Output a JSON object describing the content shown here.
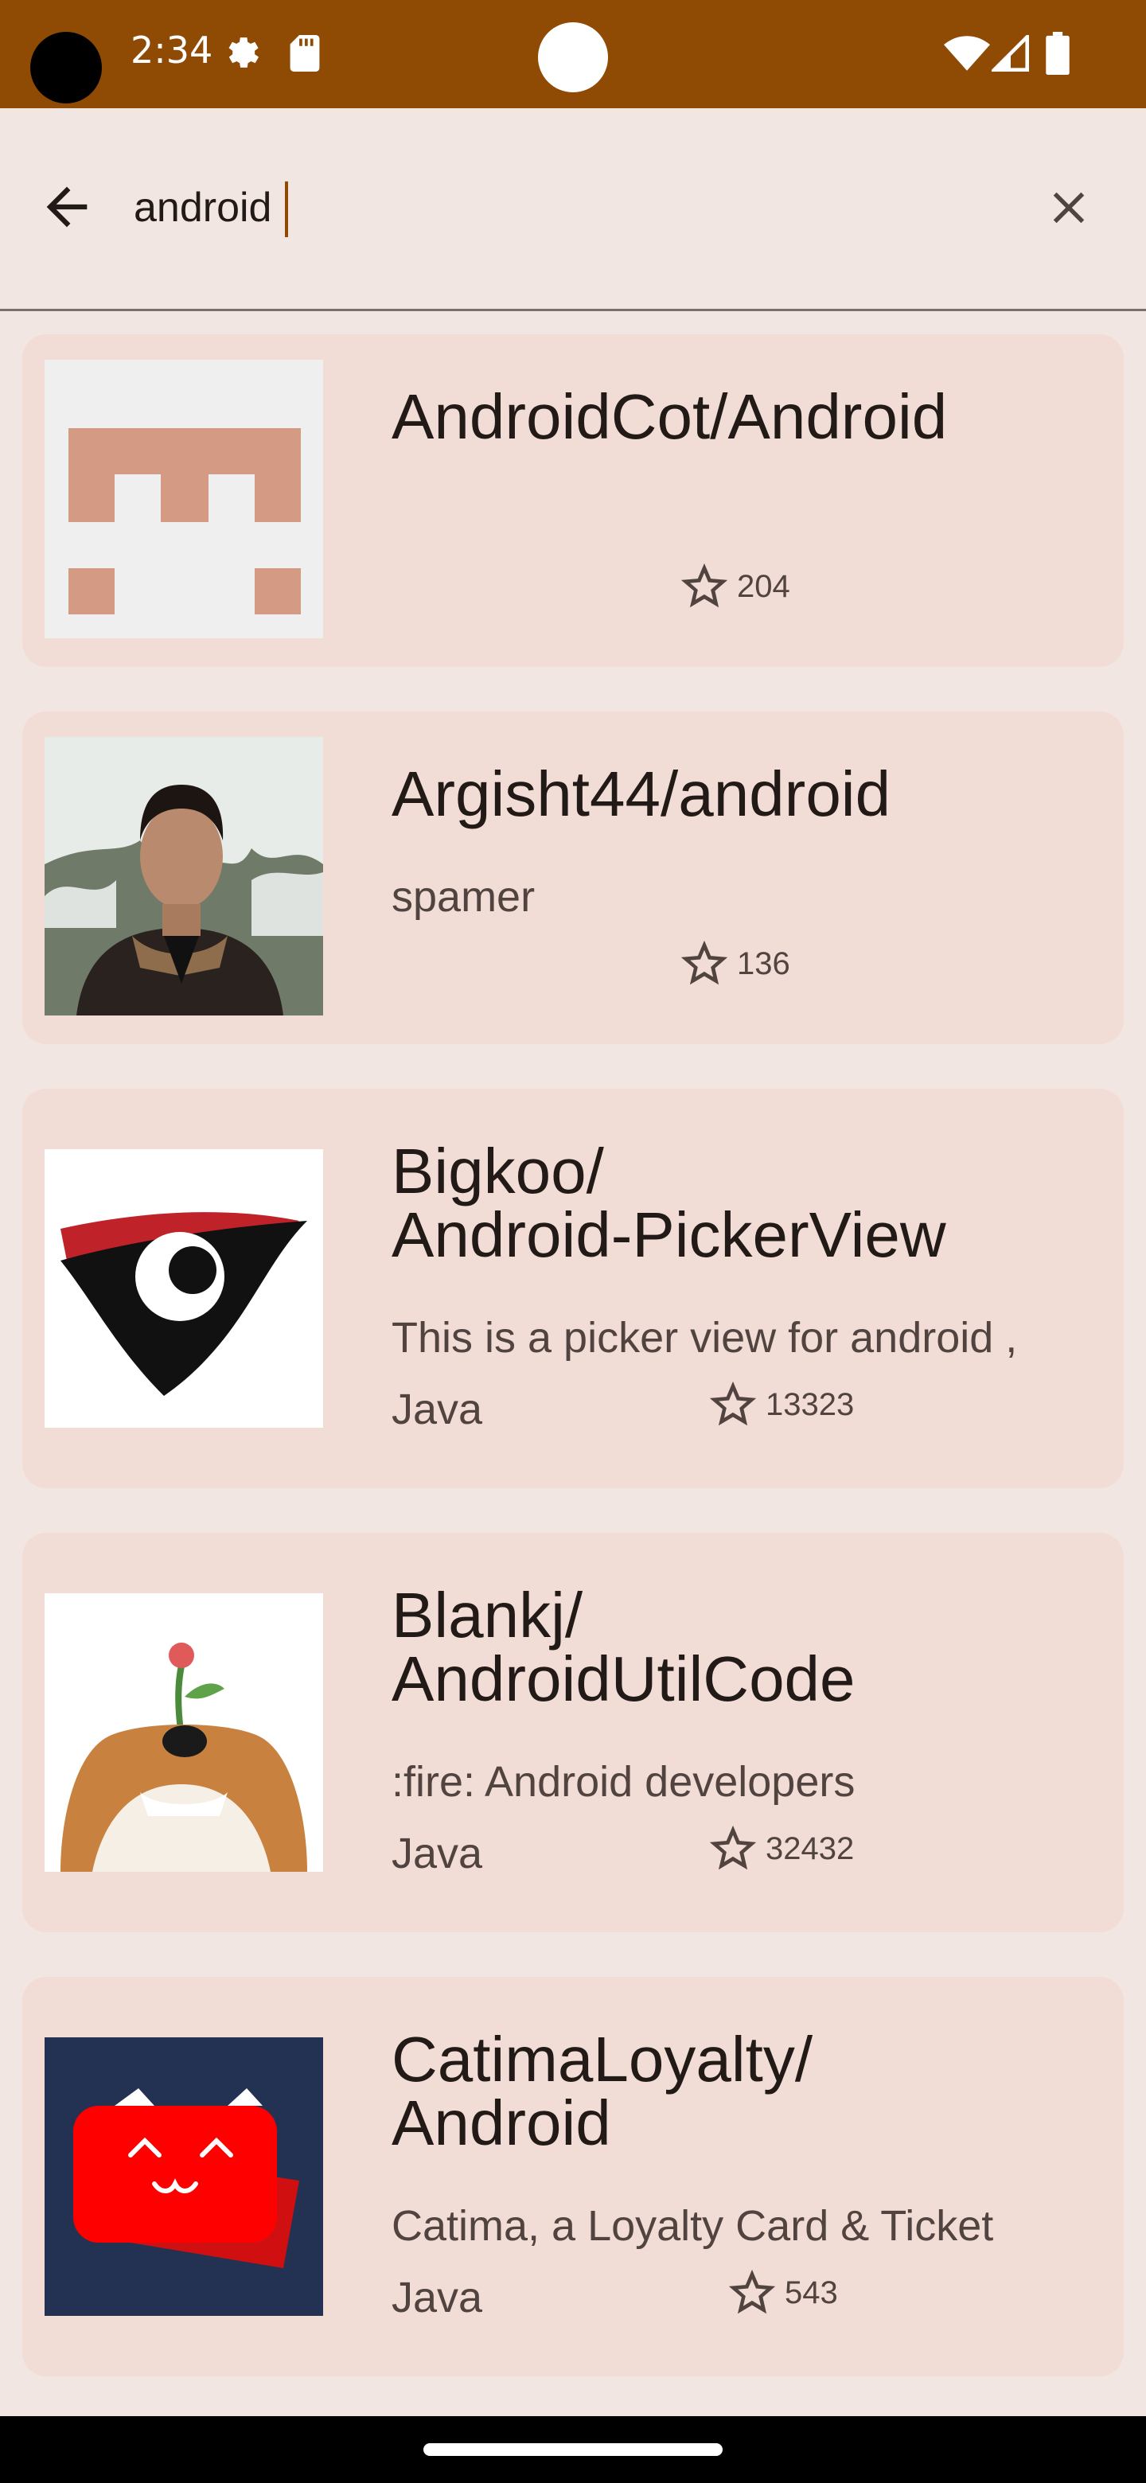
{
  "status": {
    "time": "2:34"
  },
  "search": {
    "value": "android"
  },
  "results": [
    {
      "title": "AndroidCot/Android",
      "description": "",
      "language": "",
      "stars": "204"
    },
    {
      "title": "Argisht44/android",
      "description": "spamer",
      "language": "",
      "stars": "136"
    },
    {
      "title": "Bigkoo/\nAndroid-PickerView",
      "description": "This is a picker view for android ,",
      "language": "Java",
      "stars": "13323"
    },
    {
      "title": "Blankj/\nAndroidUtilCode",
      "description": ":fire: Android developers",
      "language": "Java",
      "stars": "32432"
    },
    {
      "title": "CatimaLoyalty/\nAndroid",
      "description": "Catima, a Loyalty Card & Ticket",
      "language": "Java",
      "stars": "543"
    }
  ],
  "icons": {
    "back": "arrow-back-icon",
    "clear": "close-icon",
    "star": "star-outline-icon",
    "settings": "gear-icon",
    "sd": "sd-card-icon",
    "wifi": "wifi-icon",
    "signal": "signal-icon",
    "battery": "battery-icon"
  },
  "colors": {
    "status_bar": "#8f4a04",
    "background": "#f2e6e2",
    "card": "#f1ddd5"
  }
}
